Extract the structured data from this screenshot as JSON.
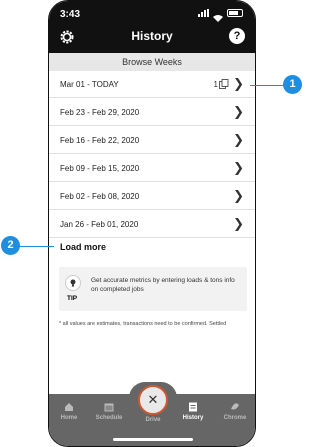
{
  "status_bar": {
    "time": "3:43"
  },
  "header": {
    "title": "History"
  },
  "section": {
    "heading": "Browse Weeks"
  },
  "weeks": [
    {
      "label": "Mar 01 - TODAY",
      "count": "1"
    },
    {
      "label": "Feb 23 - Feb 29, 2020"
    },
    {
      "label": "Feb 16 - Feb 22, 2020"
    },
    {
      "label": "Feb 09 - Feb 15, 2020"
    },
    {
      "label": "Feb 02 - Feb 08, 2020"
    },
    {
      "label": "Jan 26 - Feb 01, 2020"
    }
  ],
  "load_more": "Load more",
  "tip": {
    "label": "TIP",
    "text": "Get accurate metrics by entering loads & tons info on completed jobs"
  },
  "footnote": "* all values are estimates, transactions need to be confirmed. Settled",
  "tabs": [
    {
      "label": "Home",
      "icon": "home-icon"
    },
    {
      "label": "Schedule",
      "icon": "calendar-icon"
    },
    {
      "label": "Drive",
      "icon": "steering-wheel-icon"
    },
    {
      "label": "History",
      "icon": "history-icon",
      "active": true
    },
    {
      "label": "Chrome",
      "icon": "chrome-icon"
    }
  ],
  "callouts": [
    "1",
    "2"
  ],
  "colors": {
    "accent": "#1f8de0",
    "header_bg": "#111111",
    "tab_bg": "#666666",
    "drive_ring": "#d0582f"
  }
}
